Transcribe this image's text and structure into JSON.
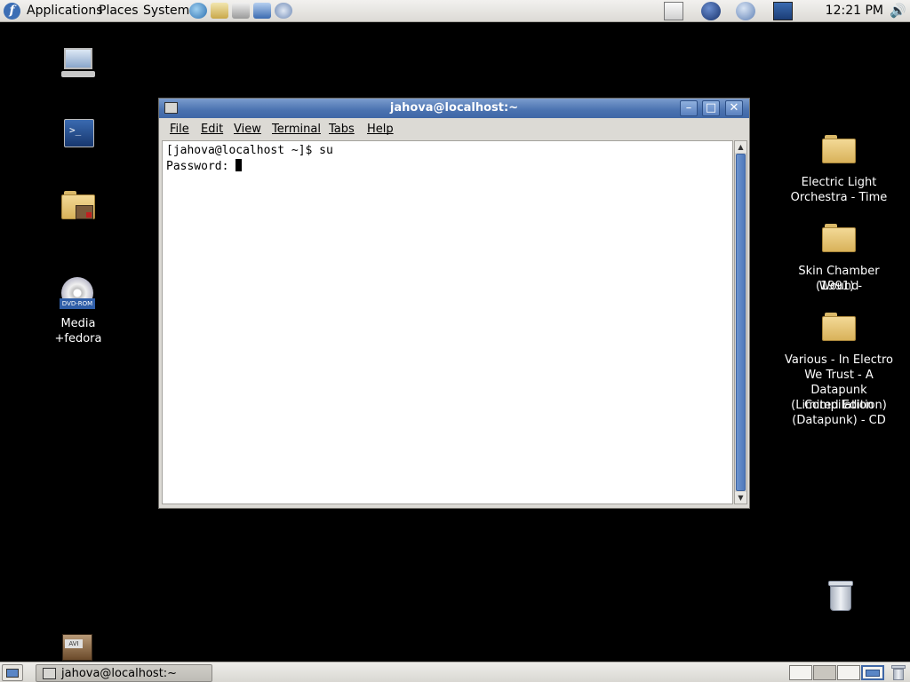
{
  "top_panel": {
    "menus": {
      "applications": "Applications",
      "places": "Places",
      "system": "System"
    },
    "launchers": [
      "web-browser-icon",
      "mail-icon",
      "office-writer-icon",
      "presentation-icon",
      "network-icon"
    ],
    "tray": [
      "notes-applet-icon",
      "network-globe-icon",
      "network-update-icon",
      "terminal-tray-icon"
    ],
    "clock": "12:21 PM",
    "volume_icon": "speaker-icon"
  },
  "desktop_icons_left": [
    {
      "name": "computer",
      "label": ""
    },
    {
      "name": "terminal-launcher",
      "label": ""
    },
    {
      "name": "home-folder",
      "label": ""
    },
    {
      "name": "media-fedora",
      "label": "Media +fedora",
      "badge": "DVD-ROM"
    }
  ],
  "desktop_icons_right": [
    {
      "label_lines": [
        "Electric Light",
        "Orchestra - Time"
      ]
    },
    {
      "label_lines": [
        "Skin Chamber (1991) -",
        "Wound"
      ]
    },
    {
      "label_lines": [
        "Various - In Electro",
        "We Trust - A",
        "Datapunk Compilation",
        "(Limited Edition)",
        "(Datapunk) - CD"
      ]
    }
  ],
  "avi_icon": {
    "badge": "AVI"
  },
  "window": {
    "title": "jahova@localhost:~",
    "menus": [
      "File",
      "Edit",
      "View",
      "Terminal",
      "Tabs",
      "Help"
    ],
    "terminal_lines": [
      "[jahova@localhost ~]$ su",
      "Password: "
    ]
  },
  "taskbar": {
    "task_label": "jahova@localhost:~"
  },
  "colors": {
    "desktop": "#000000",
    "titlebar": "#4a72b0",
    "panel": "#dcdad5",
    "active_workspace": "#5a86c6"
  }
}
